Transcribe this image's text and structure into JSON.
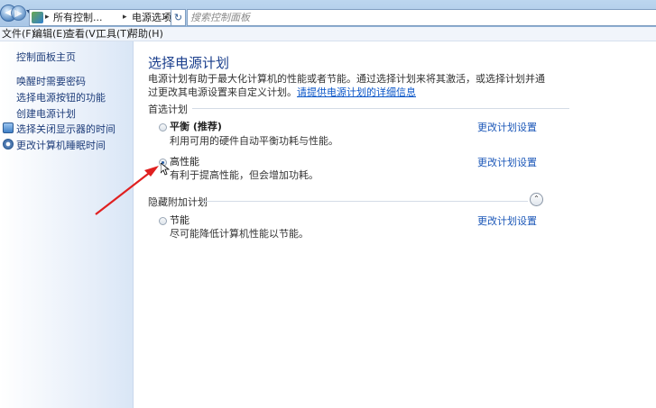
{
  "address": {
    "path_segments": [
      "所有控制...",
      "电源选项"
    ],
    "search_placeholder": "搜索控制面板",
    "refresh_glyph": "↻",
    "back_glyph": "◀",
    "forward_glyph": "▶",
    "dropdown_glyph": "▾",
    "sep_glyph": "▸"
  },
  "menu": [
    "文件(F)",
    "编辑(E)",
    "查看(V)",
    "工具(T)",
    "帮助(H)"
  ],
  "sidebar": {
    "home": "控制面板主页",
    "links": [
      {
        "label": "唤醒时需要密码",
        "icon": ""
      },
      {
        "label": "选择电源按钮的功能",
        "icon": ""
      },
      {
        "label": "创建电源计划",
        "icon": ""
      },
      {
        "label": "选择关闭显示器的时间",
        "icon": "monitor-icon"
      },
      {
        "label": "更改计算机睡眠时间",
        "icon": "clock-icon"
      }
    ]
  },
  "main": {
    "title": "选择电源计划",
    "description": "电源计划有助于最大化计算机的性能或者节能。通过选择计划来将其激活，或选择计划并通过更改其电源设置来自定义计划。",
    "description_link": "请提供电源计划的详细信息",
    "preferred_header": "首选计划",
    "hidden_header": "隐藏附加计划",
    "change_link": "更改计划设置",
    "plans": [
      {
        "name": "平衡 (推荐)",
        "desc": "利用可用的硬件自动平衡功耗与性能。",
        "selected": false
      },
      {
        "name": "高性能",
        "desc": "有利于提高性能，但会增加功耗。",
        "selected": true
      },
      {
        "name": "节能",
        "desc": "尽可能降低计算机性能以节能。",
        "selected": false
      }
    ],
    "collapse_glyph": "⌃"
  },
  "colors": {
    "annotation_arrow": "#e02020",
    "link": "#1b57b8",
    "title": "#1a3e8c"
  }
}
